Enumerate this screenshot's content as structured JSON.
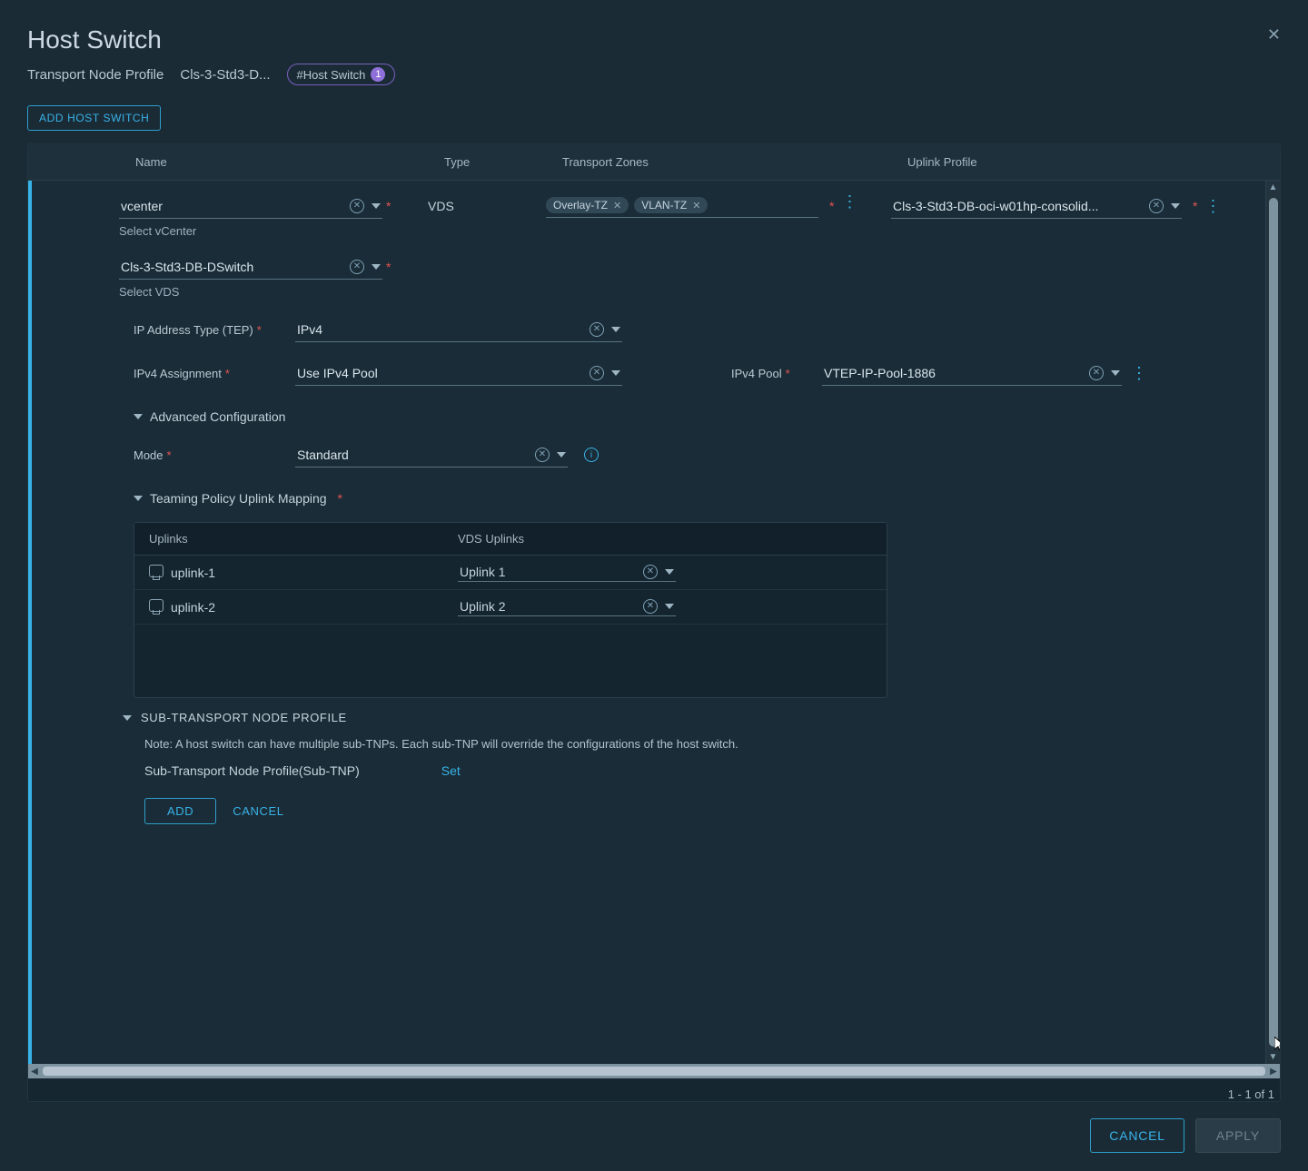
{
  "title": "Host Switch",
  "breadcrumb": {
    "a": "Transport Node Profile",
    "b": "Cls-3-Std3-D...",
    "pill_label": "#Host Switch",
    "pill_count": "1"
  },
  "add_host_switch": "ADD HOST SWITCH",
  "columns": {
    "name": "Name",
    "type": "Type",
    "tz": "Transport Zones",
    "uplink": "Uplink Profile"
  },
  "row": {
    "vcenter_value": "vcenter",
    "vcenter_hint": "Select vCenter",
    "vds_value": "Cls-3-Std3-DB-DSwitch",
    "vds_hint": "Select VDS",
    "type": "VDS",
    "tz_tags": [
      "Overlay-TZ",
      "VLAN-TZ"
    ],
    "uplink_profile": "Cls-3-Std3-DB-oci-w01hp-consolid..."
  },
  "fields": {
    "ip_type_label": "IP Address Type (TEP)",
    "ip_type_value": "IPv4",
    "ipv4_assign_label": "IPv4 Assignment",
    "ipv4_assign_value": "Use IPv4 Pool",
    "ipv4_pool_label": "IPv4 Pool",
    "ipv4_pool_value": "VTEP-IP-Pool-1886",
    "adv_cfg": "Advanced Configuration",
    "mode_label": "Mode",
    "mode_value": "Standard",
    "team_header": "Teaming Policy Uplink Mapping"
  },
  "team_table": {
    "col_uplinks": "Uplinks",
    "col_vds": "VDS Uplinks",
    "rows": [
      {
        "name": "uplink-1",
        "vds": "Uplink 1"
      },
      {
        "name": "uplink-2",
        "vds": "Uplink 2"
      }
    ]
  },
  "sub": {
    "header": "SUB-TRANSPORT NODE PROFILE",
    "note": "Note: A host switch can have multiple sub-TNPs. Each sub-TNP will override the configurations of the host switch.",
    "label": "Sub-Transport Node Profile(Sub-TNP)",
    "set": "Set",
    "add": "ADD",
    "cancel": "CANCEL"
  },
  "pager": "1 - 1 of 1",
  "footer": {
    "cancel": "CANCEL",
    "apply": "APPLY"
  }
}
